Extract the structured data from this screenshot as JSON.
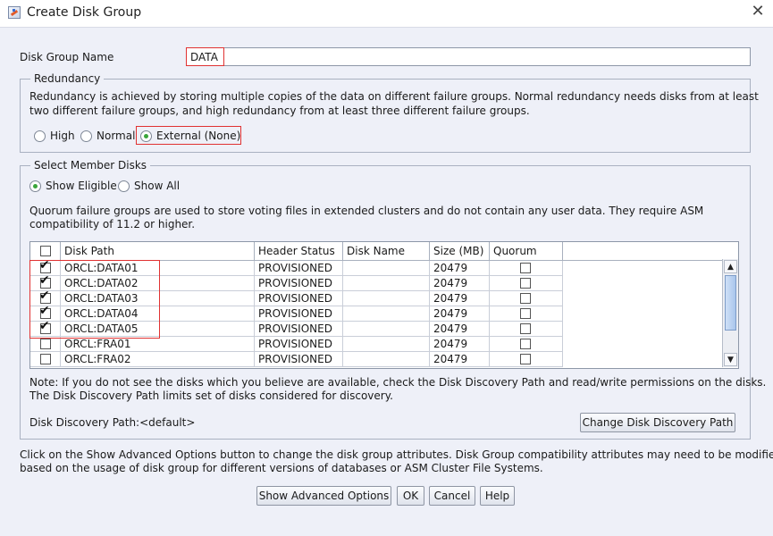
{
  "window": {
    "title": "Create Disk Group",
    "close_glyph": "✕"
  },
  "disk_group": {
    "label": "Disk Group Name",
    "value": "DATA"
  },
  "redundancy": {
    "legend": "Redundancy",
    "description_line1": "Redundancy is achieved by storing multiple copies of the data on different failure groups. Normal redundancy needs disks from at least",
    "description_line2": "two different failure groups, and high redundancy from at least three different failure groups.",
    "options": [
      {
        "label": "High",
        "selected": false
      },
      {
        "label": "Normal",
        "selected": false
      },
      {
        "label": "External (None)",
        "selected": true
      }
    ]
  },
  "member_disks": {
    "legend": "Select Member Disks",
    "filters": [
      {
        "label": "Show Eligible",
        "selected": true
      },
      {
        "label": "Show All",
        "selected": false
      }
    ],
    "quorum_note_line1": "Quorum failure groups are used to store voting files in extended clusters and do not contain any user data. They require ASM",
    "quorum_note_line2": "compatibility of 11.2 or higher.",
    "table": {
      "columns": [
        "",
        "Disk Path",
        "Header Status",
        "Disk Name",
        "Size (MB)",
        "Quorum"
      ],
      "rows": [
        {
          "checked": true,
          "path": "ORCL:DATA01",
          "status": "PROVISIONED",
          "name": "",
          "size": "20479",
          "quorum": false
        },
        {
          "checked": true,
          "path": "ORCL:DATA02",
          "status": "PROVISIONED",
          "name": "",
          "size": "20479",
          "quorum": false
        },
        {
          "checked": true,
          "path": "ORCL:DATA03",
          "status": "PROVISIONED",
          "name": "",
          "size": "20479",
          "quorum": false
        },
        {
          "checked": true,
          "path": "ORCL:DATA04",
          "status": "PROVISIONED",
          "name": "",
          "size": "20479",
          "quorum": false
        },
        {
          "checked": true,
          "path": "ORCL:DATA05",
          "status": "PROVISIONED",
          "name": "",
          "size": "20479",
          "quorum": false
        },
        {
          "checked": false,
          "path": "ORCL:FRA01",
          "status": "PROVISIONED",
          "name": "",
          "size": "20479",
          "quorum": false
        },
        {
          "checked": false,
          "path": "ORCL:FRA02",
          "status": "PROVISIONED",
          "name": "",
          "size": "20479",
          "quorum": false
        }
      ]
    },
    "discovery_note_line1": "Note: If you do not see the disks which you believe are available, check the Disk Discovery Path and read/write permissions on the disks.",
    "discovery_note_line2": "The Disk Discovery Path limits set of disks considered for discovery.",
    "discovery_path_text": "Disk Discovery Path:<default>",
    "change_path_button": "Change Disk Discovery Path"
  },
  "advanced_note_line1": "Click on the Show Advanced Options button to change the disk group attributes. Disk Group compatibility attributes may need to be modified",
  "advanced_note_line2": "based on the usage of disk group for different versions of databases or ASM Cluster File Systems.",
  "buttons": {
    "advanced": "Show Advanced Options",
    "ok": "OK",
    "cancel": "Cancel",
    "help": "Help"
  },
  "colors": {
    "highlight": "#e03232",
    "radio_selected": "#3aa53a",
    "background": "#eef0f8"
  }
}
